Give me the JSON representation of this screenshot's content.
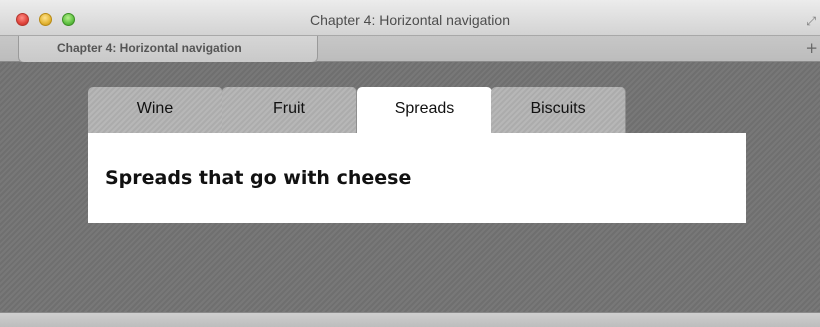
{
  "window": {
    "title": "Chapter 4: Horizontal navigation"
  },
  "document_tab": {
    "label": "Chapter 4: Horizontal navigation"
  },
  "icons": {
    "new_tab": "+",
    "fullscreen": "⤢"
  },
  "nav": {
    "tabs": [
      {
        "label": "Wine"
      },
      {
        "label": "Fruit"
      },
      {
        "label": "Spreads",
        "selected": true
      },
      {
        "label": "Biscuits"
      }
    ]
  },
  "panel": {
    "heading": "Spreads that go with cheese"
  }
}
